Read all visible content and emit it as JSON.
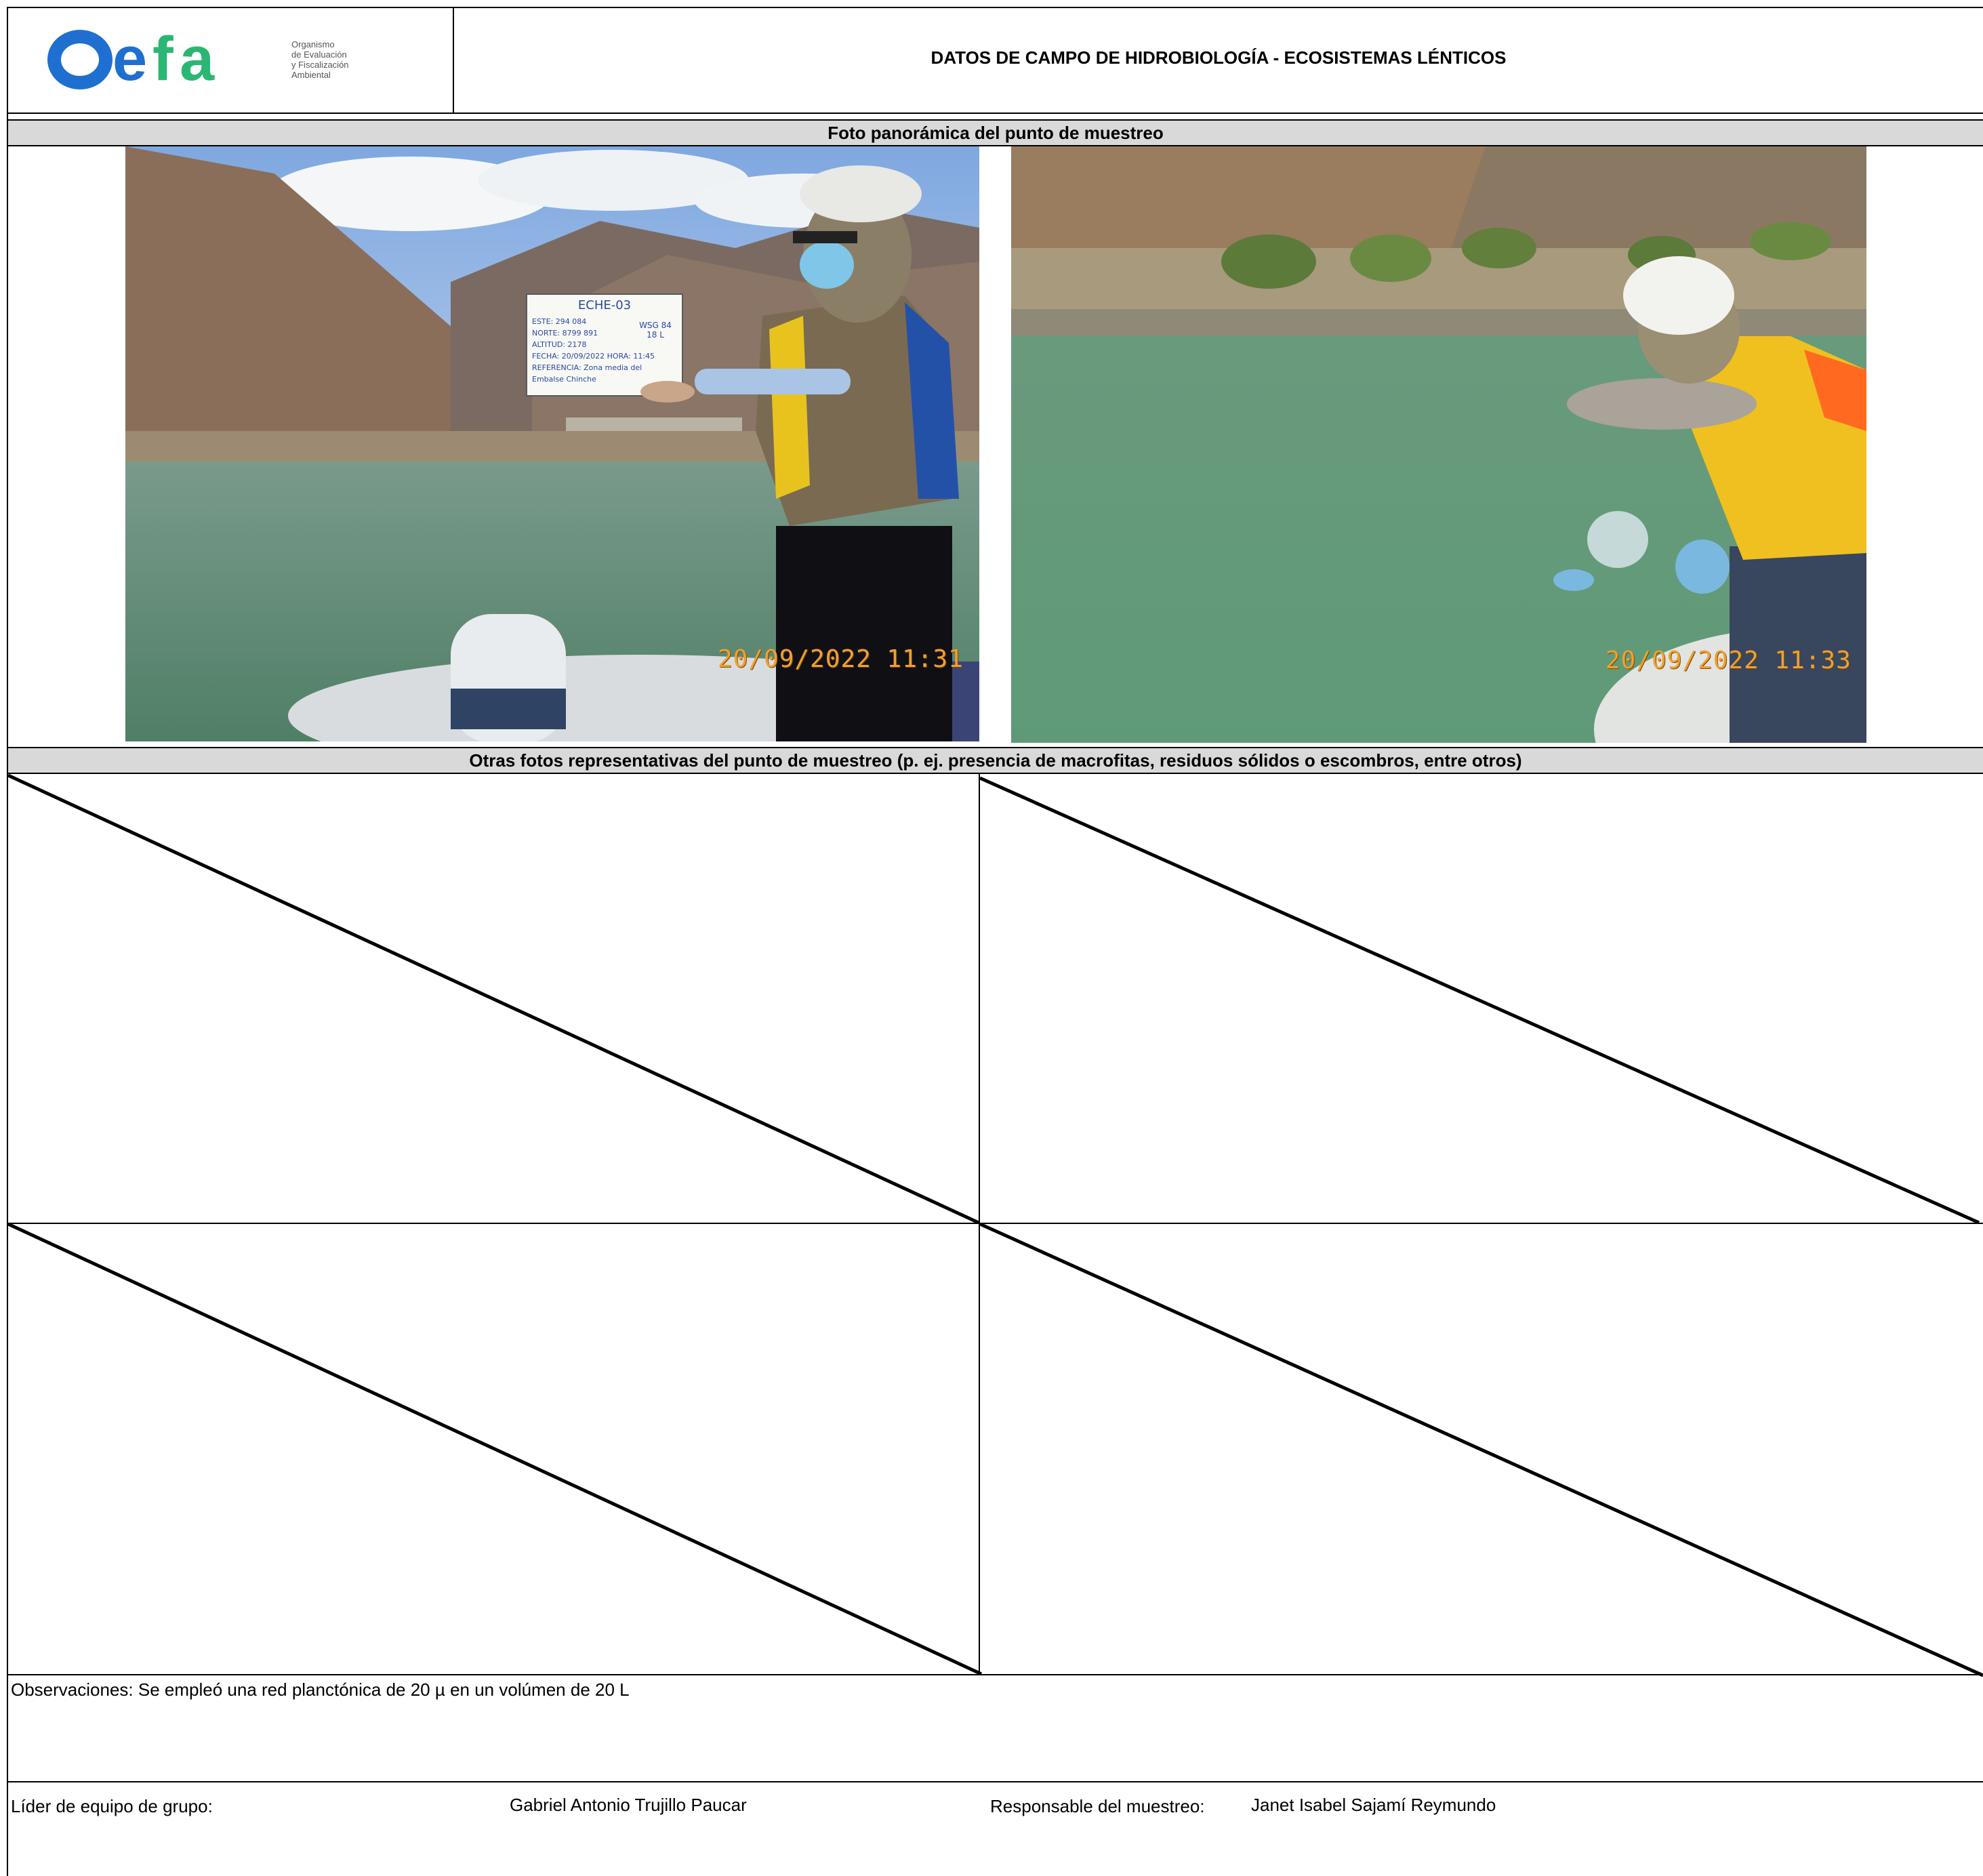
{
  "header": {
    "logo": {
      "wordmark": "Oefa",
      "tagline": [
        "Organismo",
        "de Evaluación",
        "y Fiscalización",
        "Ambiental"
      ]
    },
    "title": "DATOS DE CAMPO DE HIDROBIOLOGÍA - ECOSISTEMAS LÉNTICOS"
  },
  "sections": {
    "panoramic_title": "Foto panorámica del punto de muestreo",
    "other_photos_title": "Otras fotos representativas del punto de muestreo (p. ej. presencia de macrofitas, residuos sólidos o escombros, entre otros)"
  },
  "photos": [
    {
      "timestamp": "20/09/2022  11:31",
      "board": {
        "code": "ECHE-03",
        "lines": [
          "ESTE: 294 084",
          "NORTE: 8799 891",
          "ALTITUD: 2178",
          "FECHA: 20/09/2022  HORA: 11:45",
          "REFERENCIA: Zona media del",
          "Embalse Chinche"
        ],
        "datum": "WSG 84",
        "zone": "18 L"
      }
    },
    {
      "timestamp": "20/09/2022  11:33"
    }
  ],
  "observations": {
    "label": "Observaciones:",
    "text": "Se empleó una red planctónica de 20 µ en un volúmen de 20 L"
  },
  "footer": {
    "leader_label": "Líder de equipo de grupo:",
    "leader_name": "Gabriel Antonio Trujillo Paucar",
    "responsible_label": "Responsable del muestreo:",
    "responsible_name": "Janet Isabel Sajamí Reymundo"
  },
  "colors": {
    "logo_blue": "#1f6fd1",
    "logo_green": "#2bb673",
    "band_gray": "#d9d9d9",
    "stamp_orange": "#f0a030",
    "water_green": "#5f9a78"
  }
}
